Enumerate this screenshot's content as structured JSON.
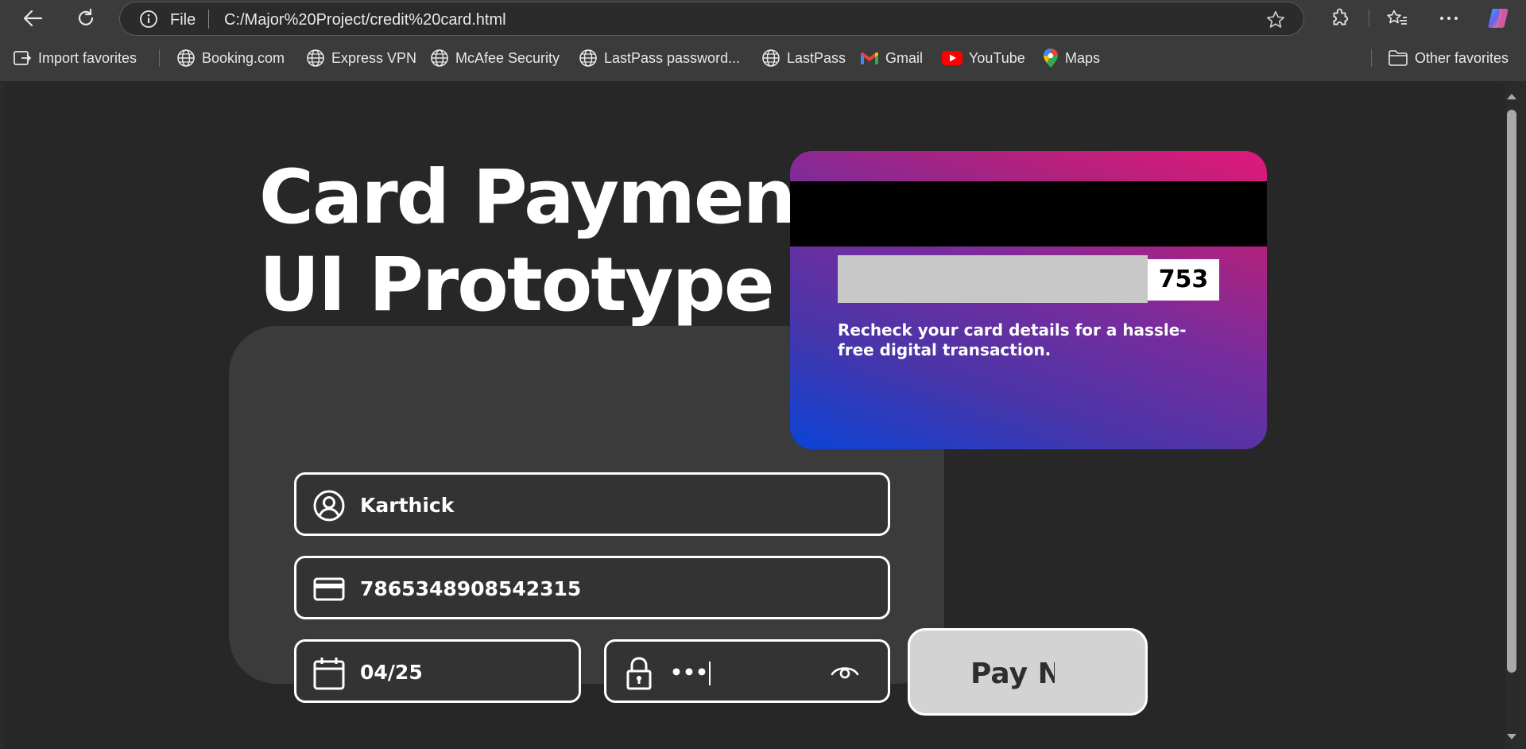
{
  "browser": {
    "address_prefix": "File",
    "url": "C:/Major%20Project/credit%20card.html"
  },
  "favorites": [
    {
      "label": "Import favorites",
      "icon": "import-icon"
    },
    {
      "label": "Booking.com",
      "icon": "globe-icon"
    },
    {
      "label": "Express VPN",
      "icon": "globe-icon"
    },
    {
      "label": "McAfee Security",
      "icon": "globe-icon"
    },
    {
      "label": "LastPass password...",
      "icon": "globe-icon"
    },
    {
      "label": "LastPass",
      "icon": "globe-icon"
    },
    {
      "label": "Gmail",
      "icon": "gmail-icon"
    },
    {
      "label": "YouTube",
      "icon": "youtube-icon"
    },
    {
      "label": "Maps",
      "icon": "maps-icon"
    }
  ],
  "other_favorites": "Other favorites",
  "page": {
    "title_line1": "Card Payment",
    "title_line2": "UI Prototype",
    "name_value": "Karthick",
    "card_number_value": "7865348908542315",
    "expiry_value": "04/25",
    "cvv_masked": "•••",
    "pay_button_label": "Pay Now"
  },
  "card_back": {
    "cvv": "753",
    "message": "Recheck your card details for a hassle-free digital transaction."
  },
  "colors": {
    "page_bg": "#272727",
    "panel_bg": "#3b3b3b",
    "card_gradient_start": "#0a43d6",
    "card_gradient_end": "#e0197a"
  }
}
